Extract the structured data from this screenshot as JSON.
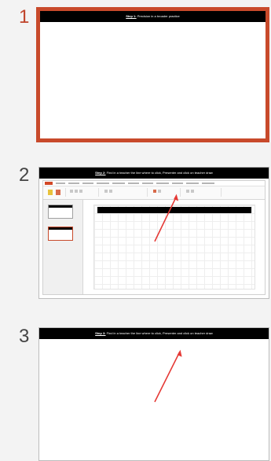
{
  "slides_pane": {
    "slides": [
      {
        "number": "1",
        "selected": true,
        "title_step": "Step 1:",
        "title_text": "Precision in a broader practice"
      },
      {
        "number": "2",
        "selected": false,
        "title_step": "Step 2:",
        "title_text": "Find in a teacher the line where to click, Presenter and click on teacher draw"
      },
      {
        "number": "3",
        "selected": false,
        "title_step": "Step 3:",
        "title_text": "Find in a teacher the line where to click, Presenter and click on teacher draw"
      }
    ]
  },
  "colors": {
    "selected_border": "#c84a2b",
    "selected_number": "#c0442b",
    "arrow": "#e53935",
    "title_bar": "#000000"
  }
}
